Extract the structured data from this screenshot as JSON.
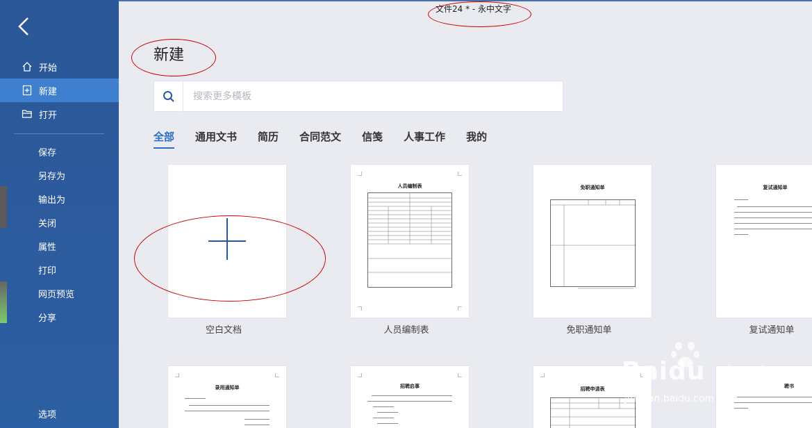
{
  "window": {
    "doc_title": "文件24 * - 永中文字"
  },
  "sidebar": {
    "back_icon": "chevron-left-icon",
    "items": [
      {
        "label": "开始",
        "icon": "home-icon"
      },
      {
        "label": "新建",
        "icon": "new-doc-icon",
        "active": true
      },
      {
        "label": "打开",
        "icon": "folder-open-icon"
      }
    ],
    "sub_items": [
      {
        "label": "保存"
      },
      {
        "label": "另存为"
      },
      {
        "label": "输出为"
      },
      {
        "label": "关闭"
      },
      {
        "label": "属性"
      },
      {
        "label": "打印"
      },
      {
        "label": "网页预览"
      },
      {
        "label": "分享"
      }
    ],
    "options_label": "选项"
  },
  "main": {
    "title": "新建",
    "search": {
      "placeholder": "搜索更多模板",
      "value": ""
    },
    "tabs": [
      {
        "label": "全部",
        "active": true
      },
      {
        "label": "通用文书"
      },
      {
        "label": "简历"
      },
      {
        "label": "合同范文"
      },
      {
        "label": "信笺"
      },
      {
        "label": "人事工作"
      },
      {
        "label": "我的"
      }
    ],
    "templates": [
      {
        "label": "空白文档"
      },
      {
        "label": "人员编制表",
        "heading": "人员编制表"
      },
      {
        "label": "免职通知单",
        "heading": "免职通知单"
      },
      {
        "label": "复试通知单",
        "heading": "复试通知单"
      }
    ],
    "templates_row2": [
      {
        "heading": "录用通知单"
      },
      {
        "heading": "招聘启事"
      },
      {
        "heading": "招聘申请表"
      },
      {
        "heading": "聘书"
      }
    ]
  },
  "watermark": {
    "brand": "Baidu",
    "brand_cn": "经验",
    "url": "jingyan.baidu.com"
  },
  "colors": {
    "sidebar": "#2b5797",
    "accent": "#2b6fc4",
    "annotation": "#cc0000"
  }
}
